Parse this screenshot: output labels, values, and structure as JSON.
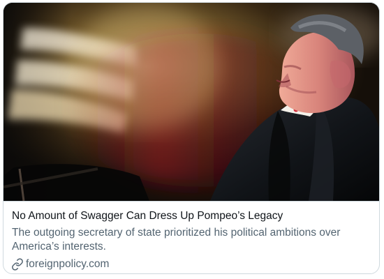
{
  "card": {
    "title": "No Amount of Swagger Can Dress Up Pompeo’s Legacy",
    "description": "The outgoing secretary of state prioritized his political ambitions over America’s interests.",
    "domain": "foreignpolicy.com",
    "icon": "link-icon"
  },
  "colors": {
    "title": "#0f1419",
    "secondary": "#536471",
    "border": "#cfd9de",
    "background": "#ffffff"
  }
}
